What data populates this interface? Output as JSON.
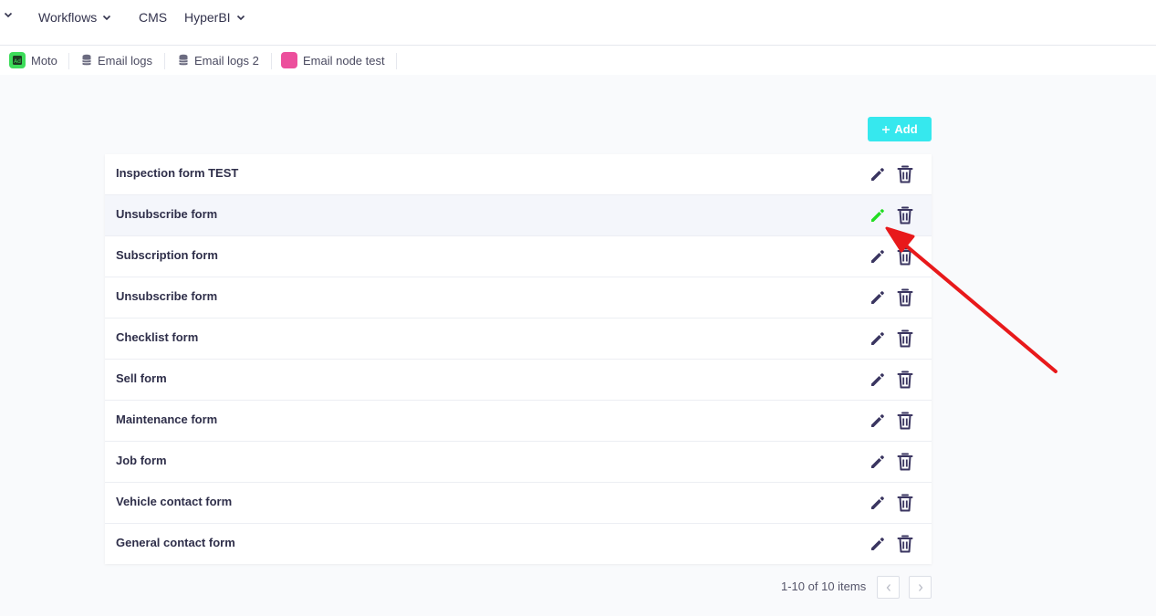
{
  "nav": {
    "items": [
      {
        "label": "",
        "has_chevron": true
      },
      {
        "label": "Workflows",
        "has_chevron": true
      },
      {
        "label": "CMS",
        "has_chevron": false
      },
      {
        "label": "HyperBI",
        "has_chevron": true
      }
    ]
  },
  "tabs": [
    {
      "label": "Moto",
      "icon": "app-icon",
      "icon_color": "#3ddc5a"
    },
    {
      "label": "Email logs",
      "icon": "database-icon"
    },
    {
      "label": "Email logs 2",
      "icon": "database-icon"
    },
    {
      "label": "Email node test",
      "icon": "app-icon",
      "icon_color": "#ec4f9c"
    }
  ],
  "toolbar": {
    "add_label": "Add",
    "add_icon": "plus-icon"
  },
  "forms": [
    {
      "name": "Inspection form TEST"
    },
    {
      "name": "Unsubscribe form",
      "hovered": true
    },
    {
      "name": "Subscription form"
    },
    {
      "name": "Unsubscribe form"
    },
    {
      "name": "Checklist form"
    },
    {
      "name": "Sell form"
    },
    {
      "name": "Maintenance form"
    },
    {
      "name": "Job form"
    },
    {
      "name": "Vehicle contact form"
    },
    {
      "name": "General contact form"
    }
  ],
  "pagination": {
    "summary": "1-10 of 10 items",
    "prev_icon": "chevron-left-icon",
    "next_icon": "chevron-right-icon"
  },
  "colors": {
    "accent": "#36e8ee",
    "icon": "#3a3560",
    "edit_hover": "#22dd22",
    "annotation_arrow": "#e8191b"
  }
}
